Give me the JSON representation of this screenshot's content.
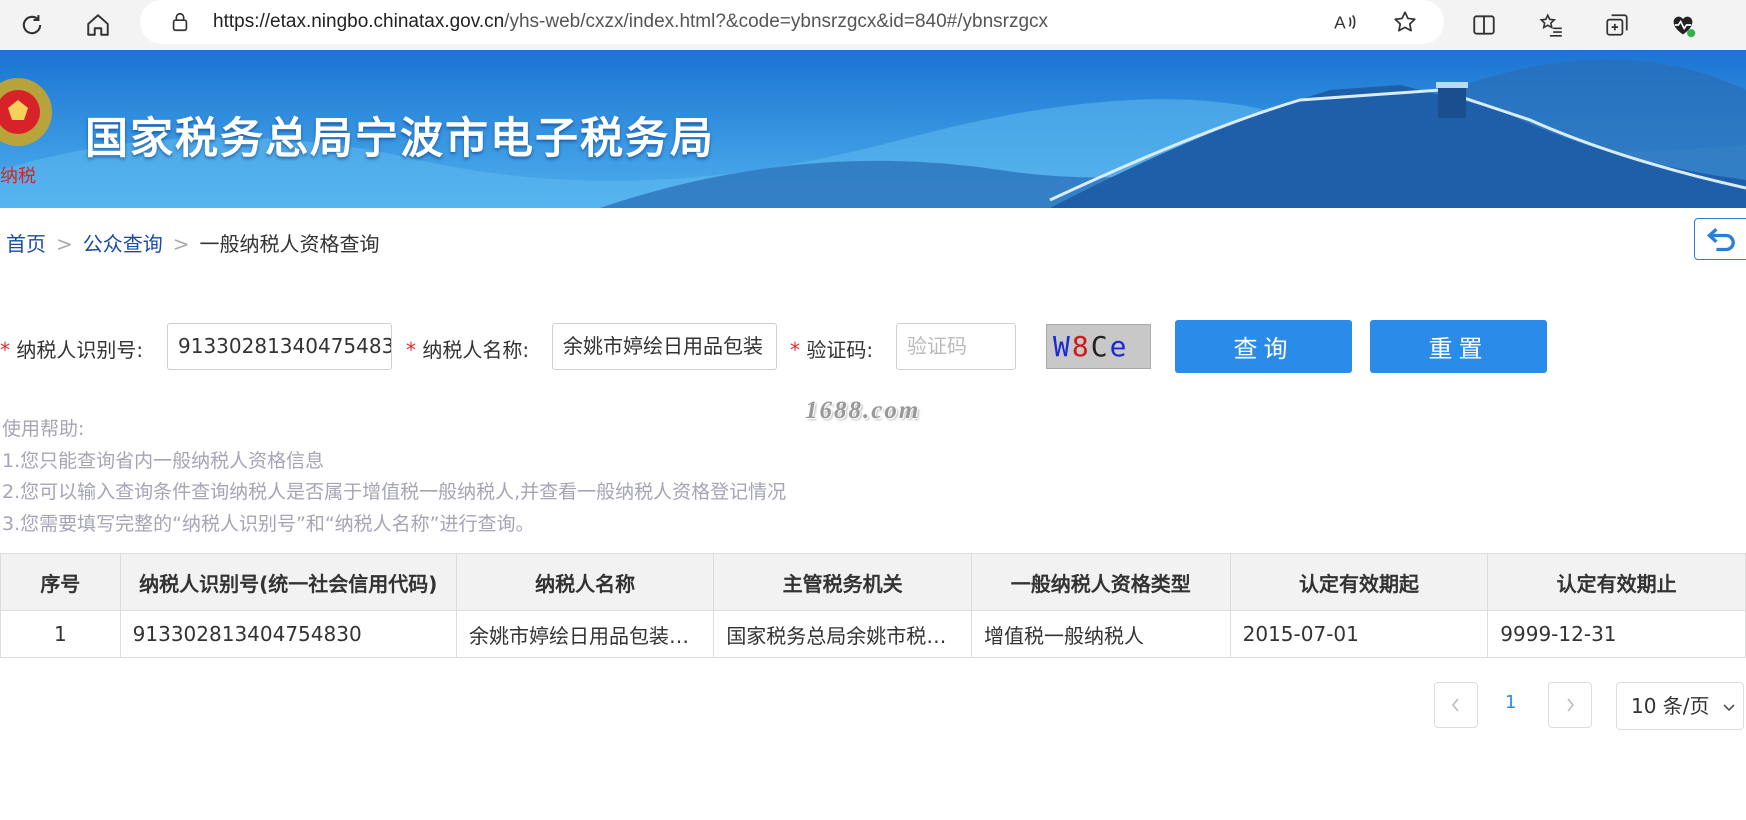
{
  "browser": {
    "url_host": "https://etax.ningbo.chinatax.gov.cn",
    "url_path": "/yhs-web/cxzx/index.html?&code=ybnsrzgcx&id=840#/ybnsrzgcx"
  },
  "banner": {
    "title": "国家税务总局宁波市电子税务局"
  },
  "breadcrumb": {
    "home": "首页",
    "public_query": "公众查询",
    "current": "一般纳税人资格查询",
    "separator": ">"
  },
  "form": {
    "required_mark": "*",
    "taxpayer_id_label": "纳税人识别号:",
    "taxpayer_id_value": "913302813404754830",
    "taxpayer_name_label": "纳税人名称:",
    "taxpayer_name_value": "余姚市婷绘日用品包装",
    "captcha_label": "验证码:",
    "captcha_placeholder": "验证码",
    "captcha_chars": [
      "W",
      "8",
      "C",
      "e"
    ],
    "captcha_colors": [
      "#1a2ad0",
      "#d01818",
      "#222222",
      "#1a2ad0"
    ],
    "query_button": "查询",
    "reset_button": "重置"
  },
  "watermark": "1688.com",
  "help": {
    "title": "使用帮助:",
    "line1": "1.您只能查询省内一般纳税人资格信息",
    "line2": "2.您可以输入查询条件查询纳税人是否属于增值税一般纳税人,并查看一般纳税人资格登记情况",
    "line3": "3.您需要填写完整的“纳税人识别号”和“纳税人名称”进行查询。"
  },
  "table": {
    "headers": [
      "序号",
      "纳税人识别号(统一社会信用代码)",
      "纳税人名称",
      "主管税务机关",
      "一般纳税人资格类型",
      "认定有效期起",
      "认定有效期止"
    ],
    "rows": [
      [
        "1",
        "913302813404754830",
        "余姚市婷绘日用品包装有限公司",
        "国家税务总局余姚市税务局",
        "增值税一般纳税人",
        "2015-07-01",
        "9999-12-31"
      ]
    ]
  },
  "pagination": {
    "current_page": "1",
    "page_size": "10 条/页"
  },
  "colors": {
    "accent": "#2a8ce8",
    "link": "#1a4aa8",
    "required": "#e02b2b",
    "help_text": "#a5a5b5"
  }
}
